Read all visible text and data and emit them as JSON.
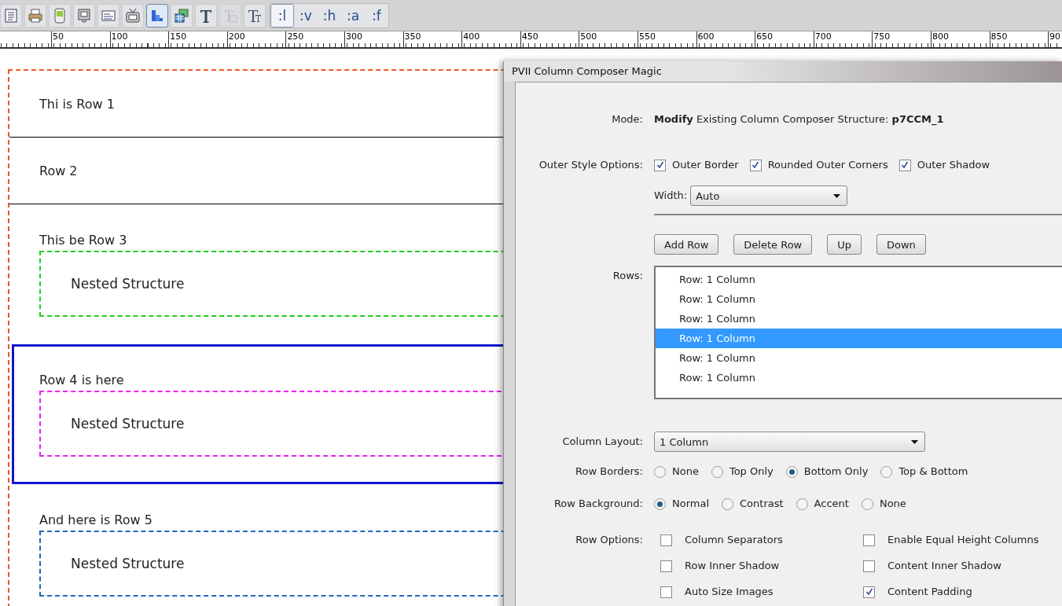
{
  "toolbar": {
    "tools": [
      {
        "kind": "page",
        "selected": false,
        "disabled": false
      },
      {
        "kind": "printer",
        "selected": false,
        "disabled": false
      },
      {
        "kind": "device",
        "selected": false,
        "disabled": false
      },
      {
        "kind": "monitor",
        "selected": false,
        "disabled": false
      },
      {
        "kind": "form",
        "selected": false,
        "disabled": false
      },
      {
        "kind": "tv",
        "selected": false,
        "disabled": false
      },
      {
        "kind": "grid",
        "selected": true,
        "disabled": false
      },
      {
        "kind": "layers",
        "selected": false,
        "disabled": false
      },
      {
        "kind": "text-large",
        "selected": false,
        "disabled": false
      },
      {
        "kind": "text-box",
        "selected": false,
        "disabled": true
      },
      {
        "kind": "text-small",
        "selected": false,
        "disabled": false
      }
    ],
    "text_buttons": [
      {
        "label": ":l",
        "selected": true
      },
      {
        "label": ":v",
        "selected": false
      },
      {
        "label": ":h",
        "selected": false
      },
      {
        "label": ":a",
        "selected": false
      },
      {
        "label": ":f",
        "selected": false
      }
    ]
  },
  "ruler": {
    "labels": [
      "50",
      "100",
      "150",
      "200",
      "250",
      "300",
      "350",
      "400",
      "450",
      "500",
      "550",
      "600",
      "650",
      "700",
      "750",
      "800",
      "850",
      "90"
    ]
  },
  "document": {
    "rows": [
      {
        "title": "Thi is Row 1",
        "selected": false
      },
      {
        "title": "Row 2",
        "selected": false
      },
      {
        "title": "This be Row 3",
        "selected": false,
        "nested": "Nested Structure",
        "color": "#22cc22"
      },
      {
        "title": "Row 4 is here",
        "selected": true,
        "nested": "Nested Structure",
        "color": "#ee22ee"
      },
      {
        "title": "And here is Row 5",
        "selected": false,
        "nested": "Nested Structure",
        "color": "#2266bb"
      }
    ]
  },
  "dialog": {
    "title": "PVII Column Composer Magic",
    "mode": {
      "label": "Mode:",
      "text": "**Modify** Existing Column Composer Structure: **p7CCM_1**"
    },
    "outer_style": {
      "label": "Outer Style Options:",
      "options": [
        {
          "label": "Outer Border",
          "checked": true
        },
        {
          "label": "Rounded Outer Corners",
          "checked": true
        },
        {
          "label": "Outer Shadow",
          "checked": true
        }
      ]
    },
    "width": {
      "label": "Width:",
      "value": "Auto"
    },
    "buttons": [
      "Add Row",
      "Delete Row",
      "Up",
      "Down"
    ],
    "rows": {
      "label": "Rows:",
      "items": [
        {
          "label": "Row: 1 Column",
          "selected": false
        },
        {
          "label": "Row: 1 Column",
          "selected": false
        },
        {
          "label": "Row: 1 Column",
          "selected": false
        },
        {
          "label": "Row: 1 Column",
          "selected": true
        },
        {
          "label": "Row: 1 Column",
          "selected": false
        },
        {
          "label": "Row: 1 Column",
          "selected": false
        }
      ]
    },
    "column_layout": {
      "label": "Column Layout:",
      "value": "1 Column"
    },
    "row_borders": {
      "label": "Row Borders:",
      "options": [
        {
          "label": "None",
          "selected": false
        },
        {
          "label": "Top Only",
          "selected": false
        },
        {
          "label": "Bottom Only",
          "selected": true
        },
        {
          "label": "Top & Bottom",
          "selected": false
        }
      ]
    },
    "row_background": {
      "label": "Row Background:",
      "options": [
        {
          "label": "Normal",
          "selected": true
        },
        {
          "label": "Contrast",
          "selected": false
        },
        {
          "label": "Accent",
          "selected": false
        },
        {
          "label": "None",
          "selected": false
        }
      ]
    },
    "row_options": {
      "label": "Row Options:",
      "options": [
        {
          "label": "Column Separators",
          "checked": false
        },
        {
          "label": "Enable Equal Height Columns",
          "checked": false
        },
        {
          "label": "Row Inner Shadow",
          "checked": false
        },
        {
          "label": "Content Inner Shadow",
          "checked": false
        },
        {
          "label": "Auto Size Images",
          "checked": false
        },
        {
          "label": "Content Padding",
          "checked": true
        }
      ]
    }
  }
}
